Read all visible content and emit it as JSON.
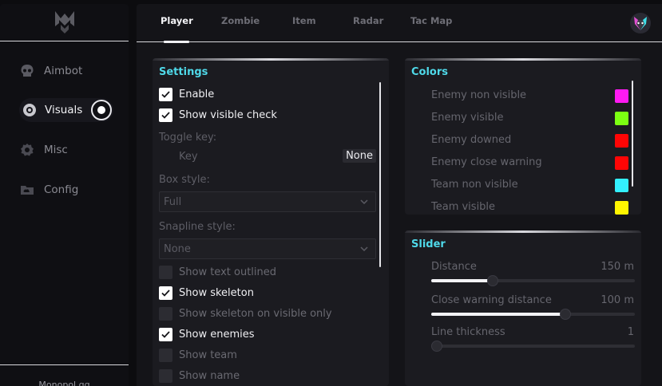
{
  "sidebar": {
    "items": [
      {
        "label": "Aimbot",
        "icon": "skull-icon",
        "active": false
      },
      {
        "label": "Visuals",
        "icon": "eye-icon",
        "active": true
      },
      {
        "label": "Misc",
        "icon": "gear-icon",
        "active": false
      },
      {
        "label": "Config",
        "icon": "cloud-folder-icon",
        "active": false
      }
    ],
    "footer": "Monopol.gg"
  },
  "tabs": [
    "Player",
    "Zombie",
    "Item",
    "Radar",
    "Tac Map"
  ],
  "active_tab": "Player",
  "settings": {
    "title": "Settings",
    "enable": {
      "label": "Enable",
      "checked": true
    },
    "show_visible_check": {
      "label": "Show visible check",
      "checked": true
    },
    "toggle_key_label": "Toggle key:",
    "key_label": "Key",
    "key_value": "None",
    "box_style_label": "Box style:",
    "box_style_value": "Full",
    "snapline_style_label": "Snapline style:",
    "snapline_style_value": "None",
    "checkboxes": [
      {
        "label": "Show text outlined",
        "checked": false
      },
      {
        "label": "Show skeleton",
        "checked": true
      },
      {
        "label": "Show skeleton on visible only",
        "checked": false
      },
      {
        "label": "Show enemies",
        "checked": true
      },
      {
        "label": "Show team",
        "checked": false
      },
      {
        "label": "Show name",
        "checked": false
      }
    ]
  },
  "colors": {
    "title": "Colors",
    "items": [
      {
        "label": "Enemy non visible",
        "color": "#ff1af2"
      },
      {
        "label": "Enemy visible",
        "color": "#7cff12"
      },
      {
        "label": "Enemy downed",
        "color": "#ff0505"
      },
      {
        "label": "Enemy close warning",
        "color": "#ff0505"
      },
      {
        "label": "Team non visible",
        "color": "#33f0ff"
      },
      {
        "label": "Team visible",
        "color": "#fff500"
      }
    ]
  },
  "slider": {
    "title": "Slider",
    "items": [
      {
        "label": "Distance",
        "value": "150 m",
        "fraction": 0.3
      },
      {
        "label": "Close warning distance",
        "value": "100 m",
        "fraction": 0.66
      },
      {
        "label": "Line thickness",
        "value": "1",
        "fraction": 0.0
      }
    ]
  },
  "accent": "#4fd9e9"
}
